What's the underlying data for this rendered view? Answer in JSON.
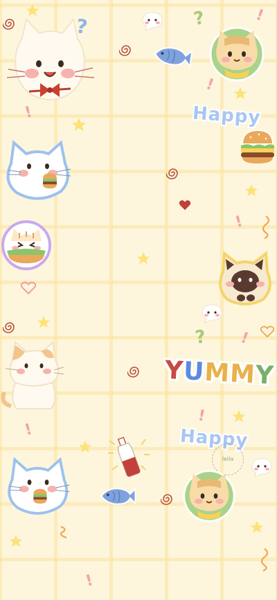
{
  "wallpaper": {
    "background_color": "#fdf6dc",
    "grid_color": "#fbe2a0",
    "words": {
      "happy_top": "Happy",
      "happy_bottom": "Happy",
      "yummy": "YUMMY"
    },
    "yummy_letter_colors": [
      "#c84a44",
      "#5b8be0",
      "#e8b14a",
      "#e8b14a",
      "#79b06a"
    ],
    "watermark_text": "leila"
  }
}
